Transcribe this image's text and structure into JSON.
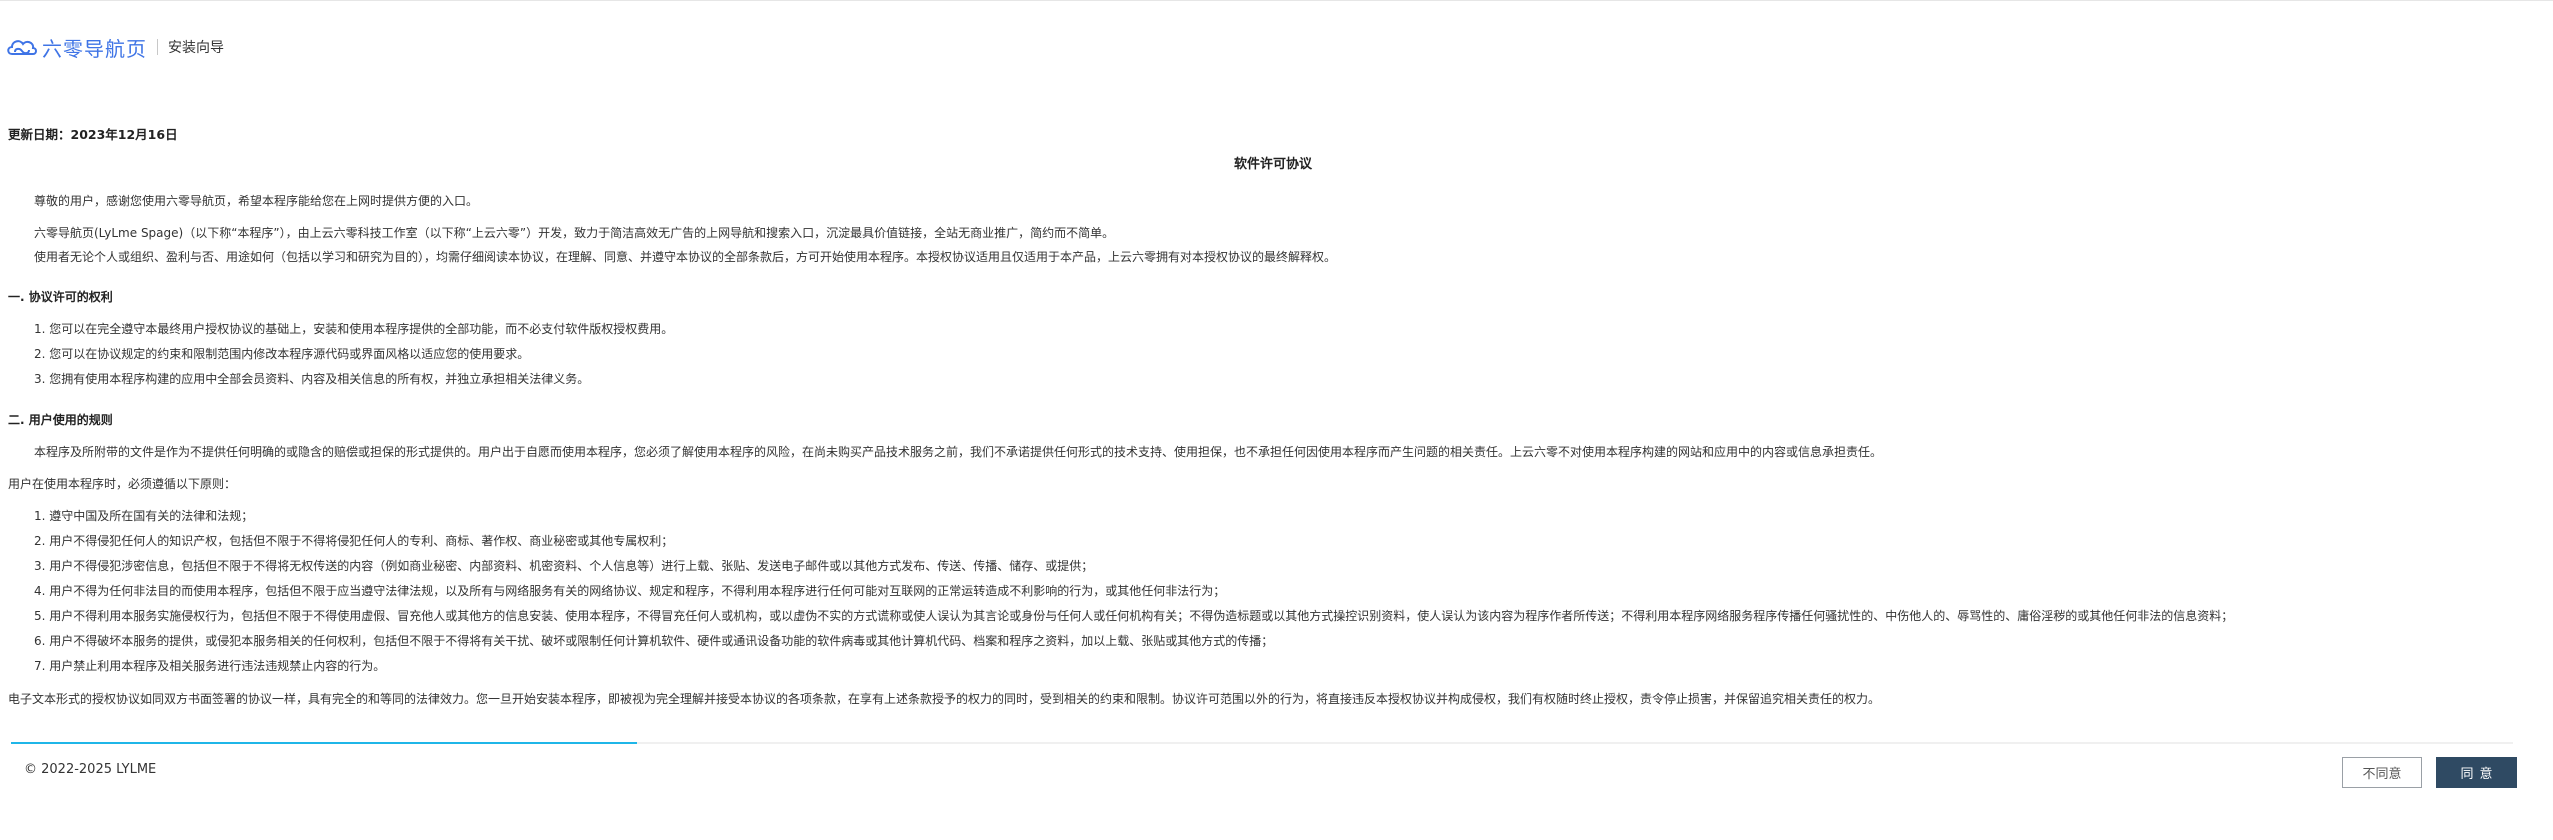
{
  "header": {
    "brand": "六零导航页",
    "subtitle": "安装向导"
  },
  "colors": {
    "brand": "#3f74e6",
    "progress": "#1fb6e8",
    "agree_button": "#2f4a63"
  },
  "update_date": "更新日期：2023年12月16日",
  "doc_title": "软件许可协议",
  "intro": [
    "尊敬的用户，感谢您使用六零导航页，希望本程序能给您在上网时提供方便的入口。",
    "六零导航页(LyLme Spage)（以下称“本程序”），由上云六零科技工作室（以下称“上云六零”）开发，致力于简洁高效无广告的上网导航和搜索入口，沉淀最具价值链接，全站无商业推广，简约而不简单。",
    "使用者无论个人或组织、盈利与否、用途如何（包括以学习和研究为目的），均需仔细阅读本协议，在理解、同意、并遵守本协议的全部条款后，方可开始使用本程序。本授权协议适用且仅适用于本产品，上云六零拥有对本授权协议的最终解释权。"
  ],
  "section1": {
    "title": "一. 协议许可的权利",
    "items": [
      "1. 您可以在完全遵守本最终用户授权协议的基础上，安装和使用本程序提供的全部功能，而不必支付软件版权授权费用。",
      "2. 您可以在协议规定的约束和限制范围内修改本程序源代码或界面风格以适应您的使用要求。",
      "3. 您拥有使用本程序构建的应用中全部会员资料、内容及相关信息的所有权，并独立承担相关法律义务。"
    ]
  },
  "section2": {
    "title": "二. 用户使用的规则",
    "para": "本程序及所附带的文件是作为不提供任何明确的或隐含的赔偿或担保的形式提供的。用户出于自愿而使用本程序，您必须了解使用本程序的风险，在尚未购买产品技术服务之前，我们不承诺提供任何形式的技术支持、使用担保，也不承担任何因使用本程序而产生问题的相关责任。上云六零不对使用本程序构建的网站和应用中的内容或信息承担责任。",
    "lead": "用户在使用本程序时，必须遵循以下原则：",
    "items": [
      "1. 遵守中国及所在国有关的法律和法规；",
      "2. 用户不得侵犯任何人的知识产权，包括但不限于不得将侵犯任何人的专利、商标、著作权、商业秘密或其他专属权利；",
      "3. 用户不得侵犯涉密信息，包括但不限于不得将无权传送的内容（例如商业秘密、内部资料、机密资料、个人信息等）进行上载、张贴、发送电子邮件或以其他方式发布、传送、传播、储存、或提供；",
      "4. 用户不得为任何非法目的而使用本程序，包括但不限于应当遵守法律法规，以及所有与网络服务有关的网络协议、规定和程序，不得利用本程序进行任何可能对互联网的正常运转造成不利影响的行为，或其他任何非法行为；",
      "5. 用户不得利用本服务实施侵权行为，包括但不限于不得使用虚假、冒充他人或其他方的信息安装、使用本程序，不得冒充任何人或机构，或以虚伪不实的方式谎称或使人误认为其言论或身份与任何人或任何机构有关；不得伪造标题或以其他方式操控识别资料，使人误认为该内容为程序作者所传送；不得利用本程序网络服务程序传播任何骚扰性的、中伤他人的、辱骂性的、庸俗淫秽的或其他任何非法的信息资料；",
      "6. 用户不得破坏本服务的提供，或侵犯本服务相关的任何权利，包括但不限于不得将有关干扰、破坏或限制任何计算机软件、硬件或通讯设备功能的软件病毒或其他计算机代码、档案和程序之资料，加以上载、张贴或其他方式的传播；",
      "7. 用户禁止利用本程序及相关服务进行违法违规禁止内容的行为。"
    ]
  },
  "closing": "电子文本形式的授权协议如同双方书面签署的协议一样，具有完全的和等同的法律效力。您一旦开始安装本程序，即被视为完全理解并接受本协议的各项条款，在享有上述条款授予的权力的同时，受到相关的约束和限制。协议许可范围以外的行为，将直接违反本授权协议并构成侵权，我们有权随时终止授权，责令停止损害，并保留追究相关责任的权力。",
  "progress": {
    "percent": 25
  },
  "footer": {
    "copyright": "© 2022-2025 LYLME",
    "disagree_label": "不同意",
    "agree_label": "同意"
  }
}
